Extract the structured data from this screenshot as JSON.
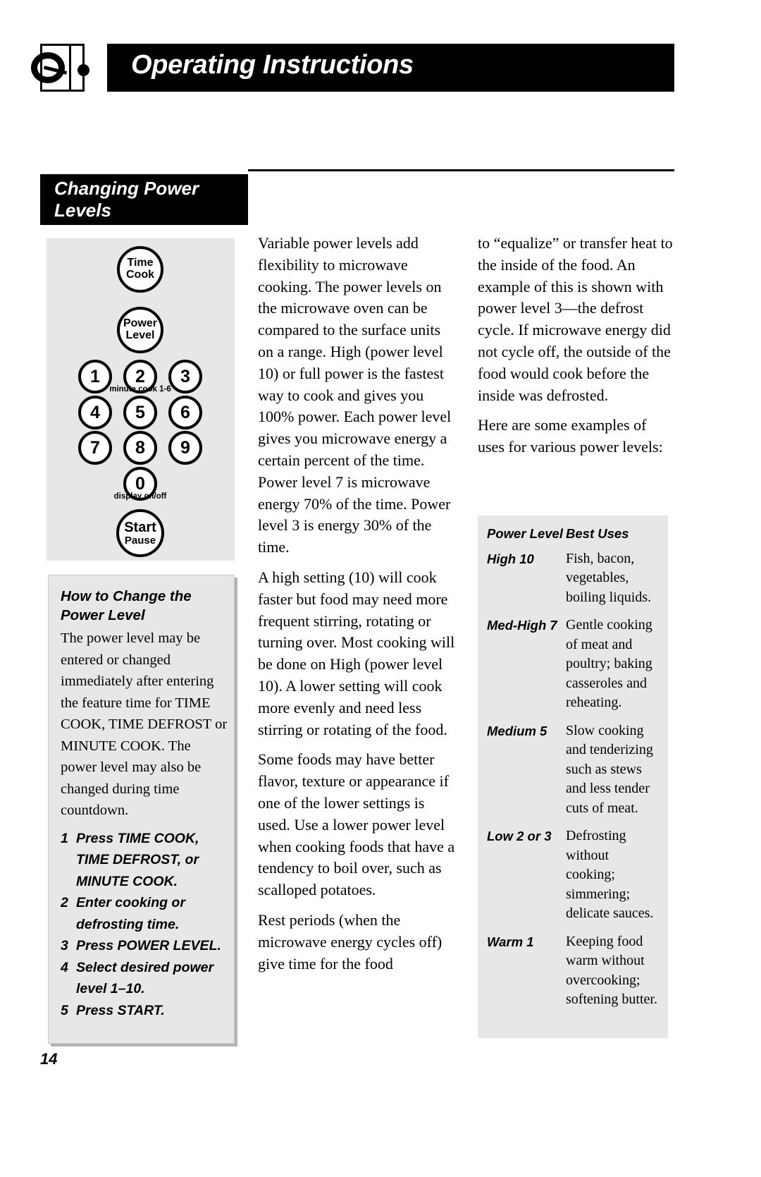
{
  "header": {
    "title": "Operating Instructions",
    "logo_icon": "microwave-door-logo-icon"
  },
  "section": {
    "title_line1": "Changing Power",
    "title_line2": "Levels"
  },
  "keypad": {
    "time_cook_line1": "Time",
    "time_cook_line2": "Cook",
    "power_level_line1": "Power",
    "power_level_line2": "Level",
    "keys": [
      "1",
      "2",
      "3",
      "4",
      "5",
      "6",
      "7",
      "8",
      "9"
    ],
    "zero_key": "0",
    "minute_cook_caption": "minute cook 1-6",
    "display_caption": "display on/off",
    "start_line1": "Start",
    "start_line2": "Pause"
  },
  "howto": {
    "heading_line1": "How to Change the",
    "heading_line2": "Power Level",
    "body": "The power level may be entered or changed immediately after entering the feature time for TIME COOK, TIME DEFROST or MINUTE COOK. The power level may also be changed during time countdown.",
    "steps": [
      {
        "num": "1",
        "text": "Press TIME COOK, TIME DEFROST, or MINUTE COOK."
      },
      {
        "num": "2",
        "text": "Enter cooking or defrosting time."
      },
      {
        "num": "3",
        "text": "Press POWER LEVEL."
      },
      {
        "num": "4",
        "text": "Select desired power level 1–10."
      },
      {
        "num": "5",
        "text": "Press START."
      }
    ]
  },
  "middle_column": {
    "p1": "Variable power levels add flexibility to microwave cooking. The power levels on the microwave oven can be compared to the surface units on a range. High (power level 10) or full power is the fastest way to cook and gives you 100% power. Each power level gives you microwave energy a certain percent of the time. Power level 7 is microwave energy 70% of the time. Power level 3 is energy 30% of the time.",
    "p2": "A high setting (10) will cook faster but food may need more frequent stirring, rotating or turning over. Most cooking will be done on High (power level 10). A lower setting will cook more evenly and need less stirring or rotating of the food.",
    "p3": "Some foods may have better flavor, texture or appearance if one of the lower settings is used. Use a lower power level when cooking foods that have a tendency to boil over, such as scalloped potatoes.",
    "p4": "Rest periods (when the microwave energy cycles off) give time for the food"
  },
  "right_column": {
    "p1": "to “equalize” or transfer heat to the inside of the food. An example of this is shown with power level 3—the defrost cycle. If microwave energy did not cycle off, the outside of the food would cook before the inside was defrosted.",
    "p2": "Here are some examples of uses for various power levels:"
  },
  "uses_table": {
    "col1_header": "Power Level",
    "col2_header": "Best Uses",
    "rows": [
      {
        "level": "High 10",
        "uses": "Fish, bacon, vegetables, boiling liquids."
      },
      {
        "level": "Med-High 7",
        "uses": "Gentle cooking of meat and poultry; baking casseroles and reheating."
      },
      {
        "level": "Medium 5",
        "uses": "Slow cooking and tenderizing such as stews and less tender cuts of meat."
      },
      {
        "level": "Low 2 or 3",
        "uses": "Defrosting without cooking; simmering; delicate sauces."
      },
      {
        "level": "Warm 1",
        "uses": "Keeping food warm without overcooking; softening butter."
      }
    ]
  },
  "footer": {
    "page_number": "14"
  },
  "colors": {
    "bar_black": "#000000",
    "panel_gray": "#e7e7e7",
    "shadow_gray": "#b4b4b4",
    "page_white": "#ffffff"
  }
}
